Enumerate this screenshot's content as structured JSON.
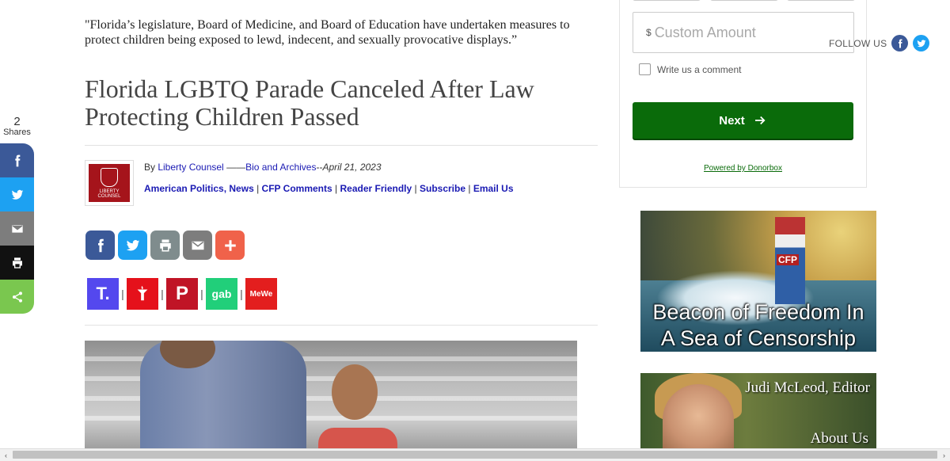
{
  "share_rail": {
    "count": "2",
    "label": "Shares",
    "buttons": [
      {
        "icon": "facebook-icon",
        "color": "#3b5998"
      },
      {
        "icon": "twitter-icon",
        "color": "#1da1f2"
      },
      {
        "icon": "email-icon",
        "color": "#7d7d7d"
      },
      {
        "icon": "print-icon",
        "color": "#111111"
      },
      {
        "icon": "share-icon",
        "color": "#7ac74f"
      }
    ]
  },
  "article": {
    "quote": "\"Florida’s legislature, Board of Medicine, and Board of Education have undertaken measures to protect children being exposed to lewd, indecent, and sexually provocative displays.”",
    "title": "Florida LGBTQ Parade Canceled After Law Protecting Children Passed",
    "byline": {
      "prefix": "By ",
      "author": "Liberty Counsel",
      "sep": " ——",
      "bio_link": "Bio and Archives",
      "date_sep": "--",
      "date": "April 21, 2023"
    },
    "logo_text": "LIBERTY COUNSEL",
    "categories": [
      "American Politics",
      "News",
      "CFP Comments",
      "Reader Friendly",
      "Subscribe",
      "Email Us"
    ],
    "social_buttons": [
      {
        "icon": "facebook-icon",
        "color": "#3b5998"
      },
      {
        "icon": "twitter-icon",
        "color": "#1da1f2"
      },
      {
        "icon": "print-icon",
        "color": "#7f8c8d"
      },
      {
        "icon": "email-icon",
        "color": "#7d7d7d"
      },
      {
        "icon": "plus-icon",
        "color": "#f0624a"
      }
    ],
    "alt_platforms": [
      {
        "name": "truth-social-icon",
        "label": "T.",
        "color": "#5448ee"
      },
      {
        "name": "gettr-icon",
        "label": "",
        "color": "#e5111b"
      },
      {
        "name": "parler-icon",
        "label": "P",
        "color": "#c01426"
      },
      {
        "name": "gab-icon",
        "label": "gab",
        "color": "#21cf7a"
      },
      {
        "name": "mewe-icon",
        "label": "MeWe",
        "color": "#e31e1e"
      }
    ]
  },
  "donate": {
    "currency": "$",
    "custom_placeholder": "Custom Amount",
    "comment_label": "Write us a comment",
    "next_label": "Next",
    "powered": "Powered by Donorbox"
  },
  "follow": {
    "label": "FOLLOW US",
    "icons": [
      {
        "icon": "facebook-icon",
        "color": "#3b5998"
      },
      {
        "icon": "twitter-icon",
        "color": "#1da1f2"
      }
    ]
  },
  "banners": {
    "beacon": {
      "line1": "Beacon of Freedom In",
      "line2": "A Sea of Censorship",
      "badge": "CFP"
    },
    "editor": {
      "name": "Judi McLeod, Editor",
      "link": "About Us"
    }
  },
  "scrollbar": {
    "left_arrow": "‹",
    "right_arrow": "›"
  }
}
